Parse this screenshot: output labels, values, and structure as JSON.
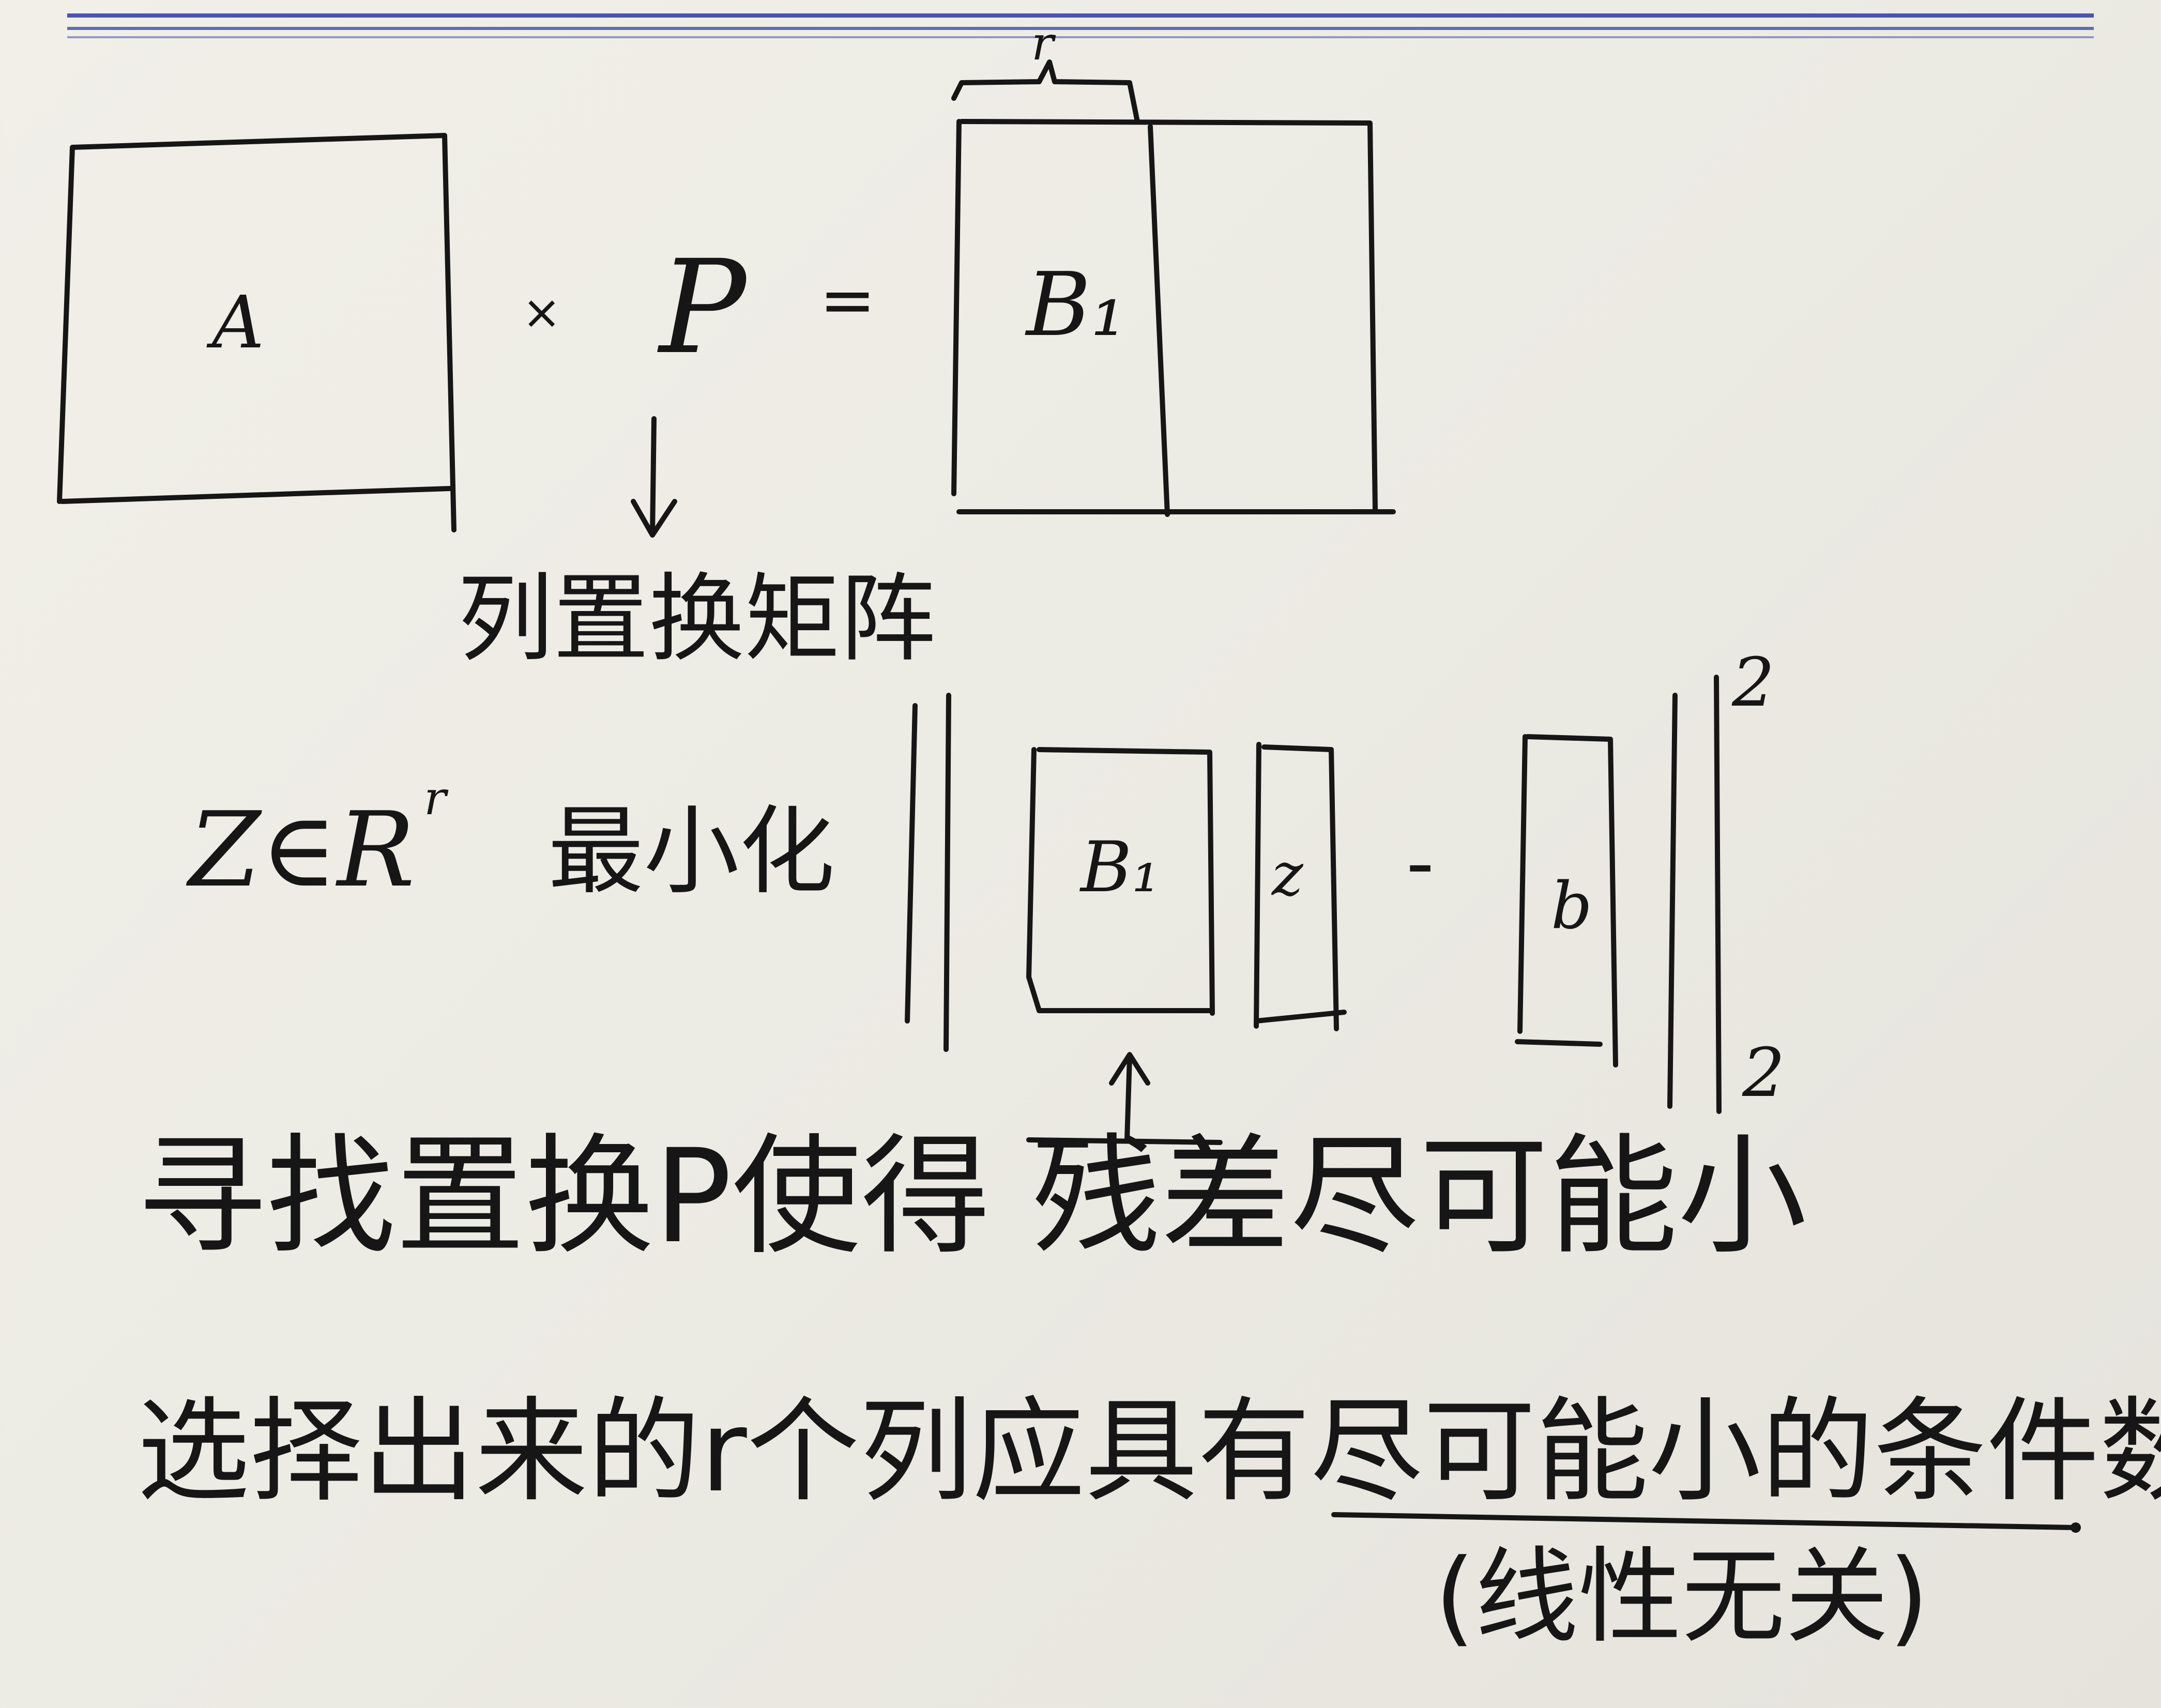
{
  "diagram": {
    "matrix_a_label": "A",
    "times_sign": "×",
    "matrix_p_label": "P",
    "equals_sign": "=",
    "block_b1_label": "B₁",
    "brace_label": "r",
    "p_caption": "列置换矩阵",
    "z_domain_z": "Z∈R",
    "z_domain_sup": "r",
    "minimize_word": "最小化",
    "norm_block_b1": "B₁",
    "norm_block_z": "z",
    "minus_sign": "-",
    "norm_block_b": "b",
    "norm_sub": "2",
    "norm_sup": "2"
  },
  "notes": {
    "line1": "寻找置换P使得 残差尽可能小",
    "line2": "选择出来的r个列应具有尽可能小的条件数.",
    "line3": "(线性无关)"
  },
  "colors": {
    "ink": "#161616",
    "paper": "#ecebe4",
    "ruling": "#4a55a8"
  }
}
